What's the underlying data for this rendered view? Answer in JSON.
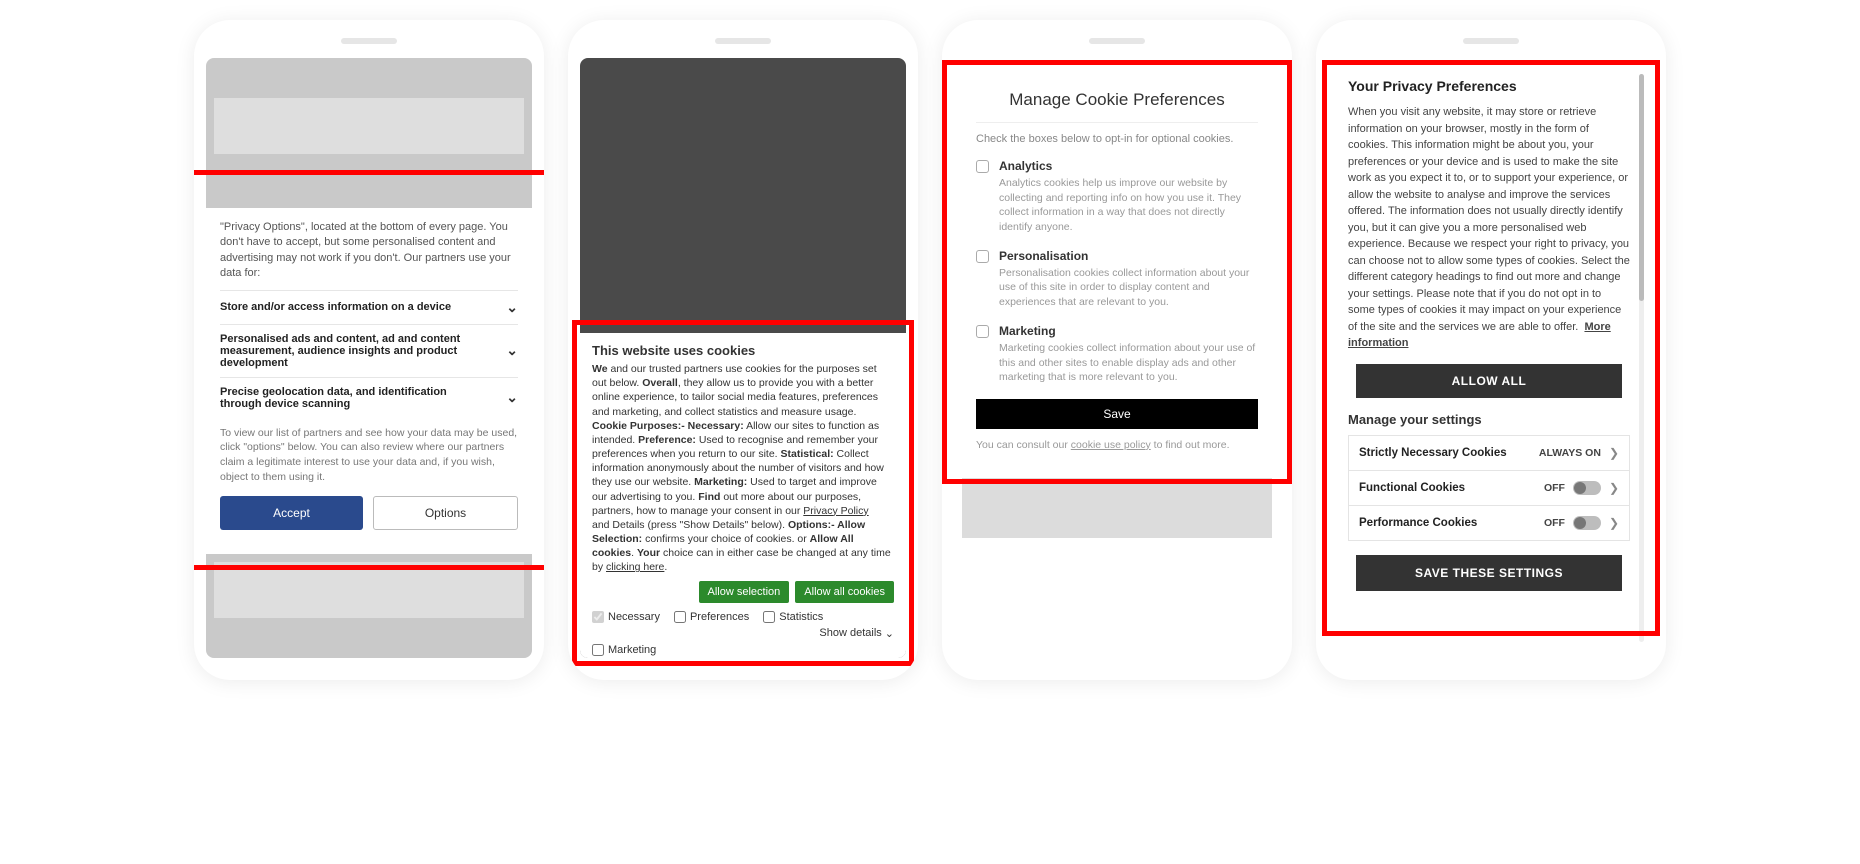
{
  "mock1": {
    "intro_text": "\"Privacy Options\", located at the bottom of every page. You don't have to accept, but some personalised content and advertising may not work if you don't. Our partners use your data for:",
    "rows": [
      "Store and/or access information on a device",
      "Personalised ads and content, ad and content measurement, audience insights and product development",
      "Precise geolocation data, and identification through device scanning"
    ],
    "footer_text": "To view our list of partners and see how your data may be used, click \"options\" below. You can also review where our partners claim a legitimate interest to use your data and, if you wish, object to them using it.",
    "accept_label": "Accept",
    "options_label": "Options"
  },
  "mock2": {
    "title": "This website uses cookies",
    "body_parts": {
      "p1a": "We",
      "p1b": " and our trusted partners use cookies for the purposes set out below. ",
      "p2a": "Overall",
      "p2b": ", they allow us to provide you with a better online experience, to tailor social media features, preferences and marketing, and collect statistics and measure usage. ",
      "p3a": "Cookie Purposes:- Necessary:",
      "p3b": " Allow our sites to function as intended. ",
      "p4a": "Preference:",
      "p4b": " Used to recognise and remember your preferences when you return to our site. ",
      "p5a": "Statistical:",
      "p5b": " Collect information anonymously about the number of visitors and how they use our website. ",
      "p6a": "Marketing:",
      "p6b": " Used to target and improve our advertising to you. ",
      "p7a": "Find",
      "p7b": " out more about our purposes, partners, how to manage your consent in our ",
      "p7link": "Privacy Policy",
      "p8": " and Details (press \"Show Details\" below). ",
      "p9a": "Options:- Allow Selection:",
      "p9b": " confirms your choice of cookies. or ",
      "p10a": "Allow All cookies",
      "p10b": ". ",
      "p11a": "Your",
      "p11b": " choice can in either case be changed at any time by ",
      "p11link": "clicking here",
      "p11c": "."
    },
    "allow_selection_label": "Allow selection",
    "allow_all_label": "Allow all cookies",
    "checks": {
      "necessary": "Necessary",
      "preferences": "Preferences",
      "statistics": "Statistics",
      "marketing": "Marketing"
    },
    "show_details": "Show details"
  },
  "mock3": {
    "title": "Manage Cookie Preferences",
    "intro": "Check the boxes below to opt-in for optional cookies.",
    "opts": [
      {
        "label": "Analytics",
        "desc": "Analytics cookies help us improve our website by collecting and reporting info on how you use it. They collect information in a way that does not directly identify anyone."
      },
      {
        "label": "Personalisation",
        "desc": "Personalisation cookies collect information about your use of this site in order to display content and experiences that are relevant to you."
      },
      {
        "label": "Marketing",
        "desc": "Marketing cookies collect information about your use of this and other sites to enable display ads and other marketing that is more relevant to you."
      }
    ],
    "save_label": "Save",
    "footer_pre": "You can consult our ",
    "footer_link": "cookie use policy",
    "footer_post": " to find out more."
  },
  "mock4": {
    "title": "Your Privacy Preferences",
    "body": "When you visit any website, it may store or retrieve information on your browser, mostly in the form of cookies. This information might be about you, your preferences or your device and is used to make the site work as you expect it to, or to support your experience, or allow the website to analyse and improve the services offered. The information does not usually directly identify you, but it can give you a more personalised web experience. Because we respect your right to privacy, you can choose not to allow some types of cookies. Select the different category headings to find out more and change your settings. Please note that if you do not opt in to some types of cookies it may impact on your experience of the site and the services we are able to offer.",
    "more_info": "More information",
    "allow_all": "ALLOW ALL",
    "manage_heading": "Manage your settings",
    "rows": [
      {
        "label": "Strictly Necessary Cookies",
        "state": "ALWAYS ON",
        "toggle": false
      },
      {
        "label": "Functional Cookies",
        "state": "OFF",
        "toggle": true
      },
      {
        "label": "Performance Cookies",
        "state": "OFF",
        "toggle": true
      }
    ],
    "save_label": "SAVE THESE SETTINGS"
  }
}
